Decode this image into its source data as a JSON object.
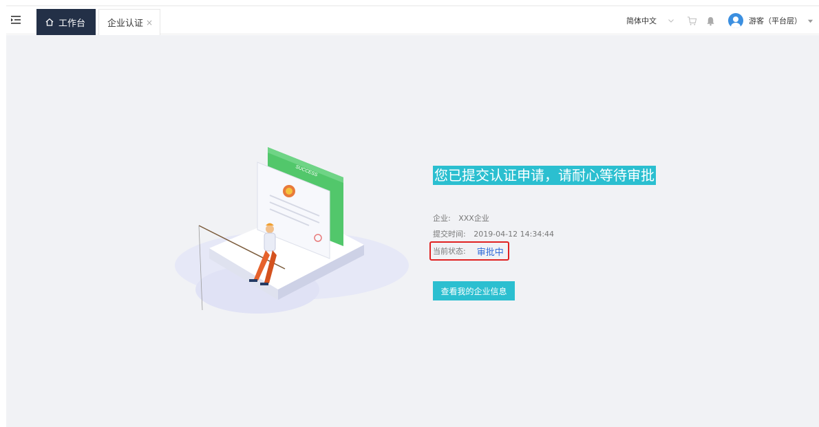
{
  "tabs": [
    {
      "label": "工作台"
    },
    {
      "label": "企业认证",
      "close": "×"
    }
  ],
  "header": {
    "language": "简体中文",
    "user": "游客（平台层）"
  },
  "main": {
    "message": "您已提交认证申请，请耐心等待审批",
    "enterprise_label": "企业:",
    "enterprise_value": "XXX企业",
    "time_label": "提交时间:",
    "time_value": "2019-04-12 14:34:44",
    "status_label": "当前状态:",
    "status_value": "审批中",
    "button": "查看我的企业信息",
    "illustration_badge": "SUCCESS"
  },
  "colors": {
    "accent": "#2bbfd0",
    "nav_dark": "#233047",
    "status_blue": "#2f6ad8",
    "highlight_red": "#e02020",
    "certificate_green": "#52c76b"
  },
  "icons": [
    "menu-toggle-icon",
    "home-icon",
    "chevron-down-icon",
    "cart-icon",
    "bell-icon",
    "avatar",
    "caret-down-icon"
  ]
}
